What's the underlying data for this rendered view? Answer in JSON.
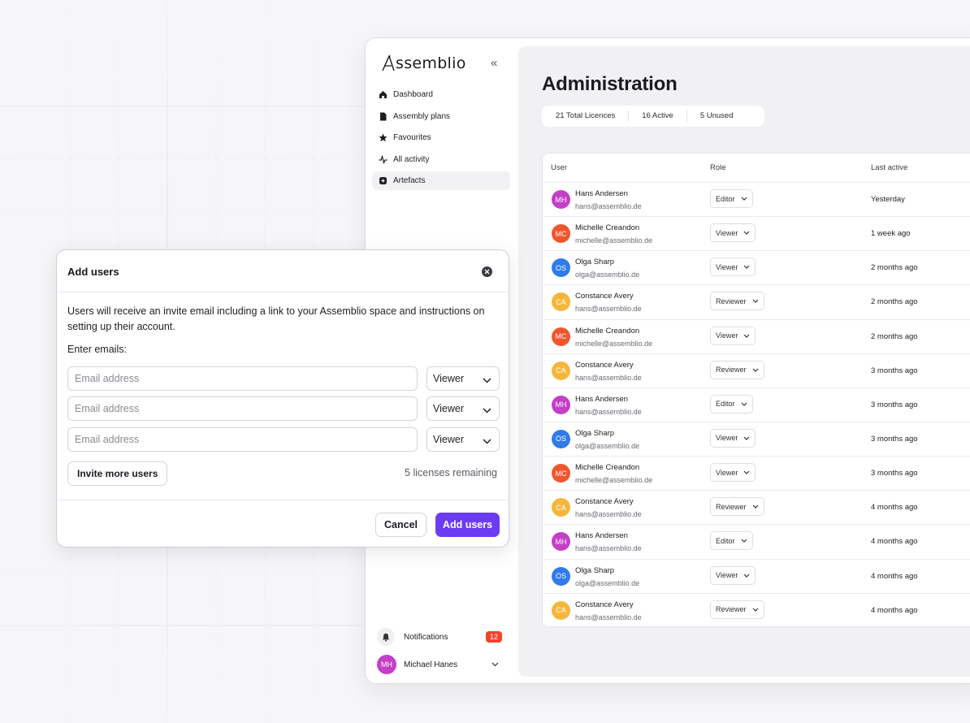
{
  "app": {
    "logo_text": "ssemblio",
    "nav": [
      {
        "label": "Dashboard",
        "icon": "home-icon"
      },
      {
        "label": "Assembly plans",
        "icon": "document-icon"
      },
      {
        "label": "Favourites",
        "icon": "star-icon"
      },
      {
        "label": "All activity",
        "icon": "activity-icon"
      },
      {
        "label": "Artefacts",
        "icon": "box-icon"
      }
    ],
    "notifications": {
      "label": "Notifications",
      "count": "12"
    },
    "current_user": {
      "initials": "MH",
      "name": "Michael Hanes",
      "color": "#c43fc8"
    }
  },
  "admin": {
    "title": "Administration",
    "stats": [
      "21 Total Licences",
      "16 Active",
      "5 Unused"
    ],
    "columns": {
      "user": "User",
      "role": "Role",
      "last": "Last active"
    },
    "rows": [
      {
        "initials": "MH",
        "color": "#c43fc8",
        "name": "Hans Andersen",
        "email": "hans@assemblio.de",
        "role": "Editor",
        "last": "Yesterday"
      },
      {
        "initials": "MC",
        "color": "#f0562e",
        "name": "Michelle Creandon",
        "email": "michelle@assemblio.de",
        "role": "Viewer",
        "last": "1 week ago"
      },
      {
        "initials": "OS",
        "color": "#2f7be8",
        "name": "Olga Sharp",
        "email": "olga@assemblio.de",
        "role": "Viewer",
        "last": "2 months ago"
      },
      {
        "initials": "CA",
        "color": "#f5b73b",
        "name": "Constance Avery",
        "email": "hans@assemblio.de",
        "role": "Reviewer",
        "last": "2 months ago"
      },
      {
        "initials": "MC",
        "color": "#f0562e",
        "name": "Michelle Creandon",
        "email": "michelle@assemblio.de",
        "role": "Viewer",
        "last": "2 months ago"
      },
      {
        "initials": "CA",
        "color": "#f5b73b",
        "name": "Constance Avery",
        "email": "hans@assemblio.de",
        "role": "Reviewer",
        "last": "3 months ago"
      },
      {
        "initials": "MH",
        "color": "#c43fc8",
        "name": "Hans Andersen",
        "email": "hans@assemblio.de",
        "role": "Editor",
        "last": "3 months ago"
      },
      {
        "initials": "OS",
        "color": "#2f7be8",
        "name": "Olga Sharp",
        "email": "olga@assemblio.de",
        "role": "Viewer",
        "last": "3 months ago"
      },
      {
        "initials": "MC",
        "color": "#f0562e",
        "name": "Michelle Creandon",
        "email": "michelle@assemblio.de",
        "role": "Viewer",
        "last": "3 months ago"
      },
      {
        "initials": "CA",
        "color": "#f5b73b",
        "name": "Constance Avery",
        "email": "hans@assemblio.de",
        "role": "Reviewer",
        "last": "4 months ago"
      },
      {
        "initials": "MH",
        "color": "#c43fc8",
        "name": "Hans Andersen",
        "email": "hans@assemblio.de",
        "role": "Editor",
        "last": "4 months ago"
      },
      {
        "initials": "OS",
        "color": "#2f7be8",
        "name": "Olga Sharp",
        "email": "olga@assemblio.de",
        "role": "Viewer",
        "last": "4 months ago"
      },
      {
        "initials": "CA",
        "color": "#f5b73b",
        "name": "Constance Avery",
        "email": "hans@assemblio.de",
        "role": "Reviewer",
        "last": "4 months ago"
      }
    ]
  },
  "modal": {
    "title": "Add users",
    "description": "Users will receive an invite email including a link to your Assemblio space and instructions on setting up their account.",
    "enter_label": "Enter emails:",
    "email_placeholder": "Email address",
    "email_rows": [
      {
        "value": "",
        "role": "Viewer"
      },
      {
        "value": "",
        "role": "Viewer"
      },
      {
        "value": "",
        "role": "Viewer"
      }
    ],
    "invite_more": "Invite more users",
    "remaining": "5 licenses remaining",
    "cancel": "Cancel",
    "submit": "Add users"
  },
  "colors": {
    "accent": "#6b3cf2",
    "badge": "#f0442c"
  }
}
